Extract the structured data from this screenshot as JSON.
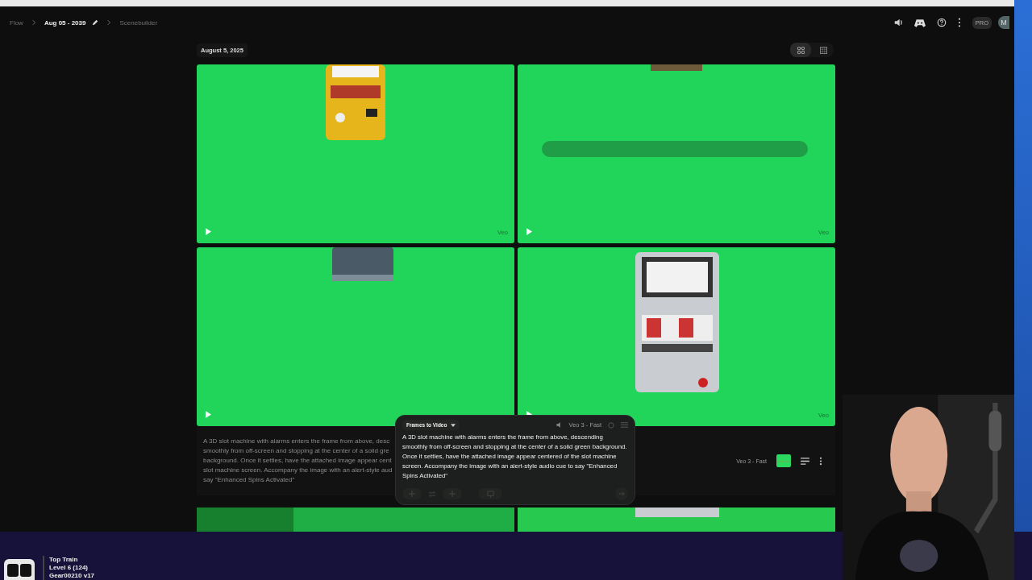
{
  "breadcrumbs": [
    {
      "label": "Flow",
      "current": false
    },
    {
      "label": "Aug 05 - 2039",
      "current": true,
      "editable": true
    },
    {
      "label": "Scenebuilder",
      "current": false
    }
  ],
  "header": {
    "badge": "PRO",
    "avatar": "M"
  },
  "date": "August 5, 2025",
  "views": [
    {
      "kind": "grid",
      "selected": true
    },
    {
      "kind": "list",
      "selected": false
    }
  ],
  "tiles": [
    {
      "kind": "picture",
      "badge": "Veo"
    },
    {
      "kind": "picture",
      "badge": "Veo"
    },
    {
      "kind": "picture"
    },
    {
      "kind": "picture",
      "badge": "Veo"
    }
  ],
  "description_lines": [
    "A 3D slot machine with alarms enters the frame from above, desc",
    "smoothly from off-screen and stopping at the center of a solid gre",
    "background. Once it settles, have the attached image appear cent",
    "slot machine screen. Accompany the image with an alert-style aud",
    "say \"Enhanced Spins Activated\""
  ],
  "model": "Veo 3 - Fast",
  "prompt_panel": {
    "mode": "Frames to Video",
    "model": "Veo 3 - Fast",
    "prompt": "A 3D slot machine with alarms enters the frame from above, descending smoothly from off-screen and stopping at the center of a solid green background. Once it settles, have the attached image appear centered of the slot machine screen. Accompany the image with an alert-style audio cue to say \"Enhanced Spins Activated\""
  },
  "stream_overlay": {
    "lines": [
      "Top Train",
      "Level 6  (124)",
      "Gear00210 v17"
    ]
  },
  "webcam": {
    "kind": "picture"
  }
}
